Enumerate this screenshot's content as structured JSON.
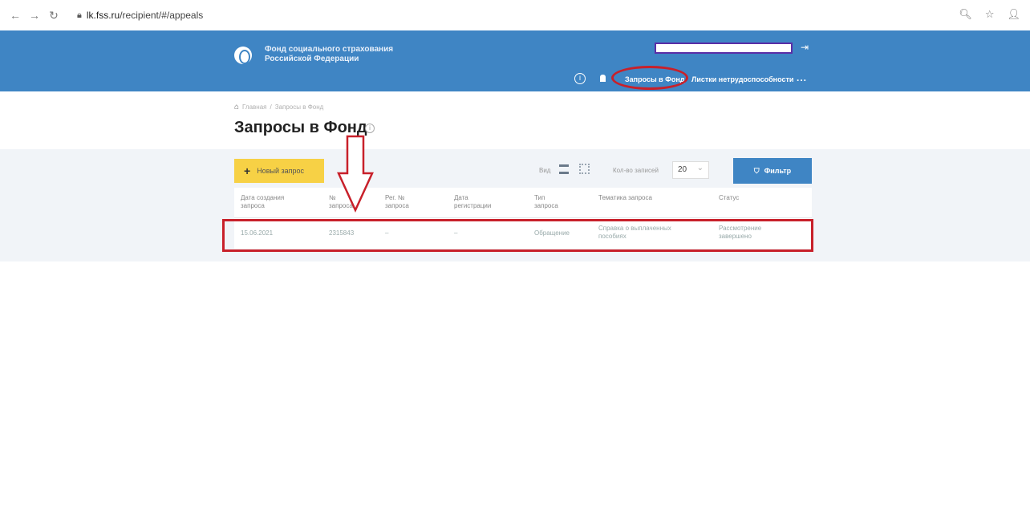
{
  "browser": {
    "url_domain": "lk.fss.ru",
    "url_path": "/recipient/#/appeals"
  },
  "header": {
    "org_name_line1": "Фонд социального страхования",
    "org_name_line2": "Российской Федерации",
    "nav_requests": "Запросы в Фонд",
    "nav_sick_leave": "Листки нетрудоспособности",
    "nav_more": "..."
  },
  "breadcrumb": {
    "home": "Главная",
    "current": "Запросы в Фонд"
  },
  "page": {
    "title": "Запросы в Фонд"
  },
  "toolbar": {
    "new_request": "Новый запрос",
    "view_label": "Вид",
    "per_page_label": "Кол-во записей",
    "per_page_value": "20",
    "filter_label": "Фильтр"
  },
  "table": {
    "columns": [
      {
        "line1": "Дата создания",
        "line2": "запроса"
      },
      {
        "line1": "№",
        "line2": "запроса"
      },
      {
        "line1": "Рег. №",
        "line2": "запроса"
      },
      {
        "line1": "Дата",
        "line2": "регистрации"
      },
      {
        "line1": "Тип",
        "line2": "запроса"
      },
      {
        "line1": "Тематика запроса",
        "line2": ""
      },
      {
        "line1": "Статус",
        "line2": ""
      }
    ],
    "rows": [
      {
        "created": "15.06.2021",
        "number": "2315843",
        "reg_number": "–",
        "reg_date": "–",
        "type": "Обращение",
        "topic_line1": "Справка о выплаченных",
        "topic_line2": "пособиях",
        "status_line1": "Рассмотрение",
        "status_line2": "завершено"
      }
    ]
  }
}
